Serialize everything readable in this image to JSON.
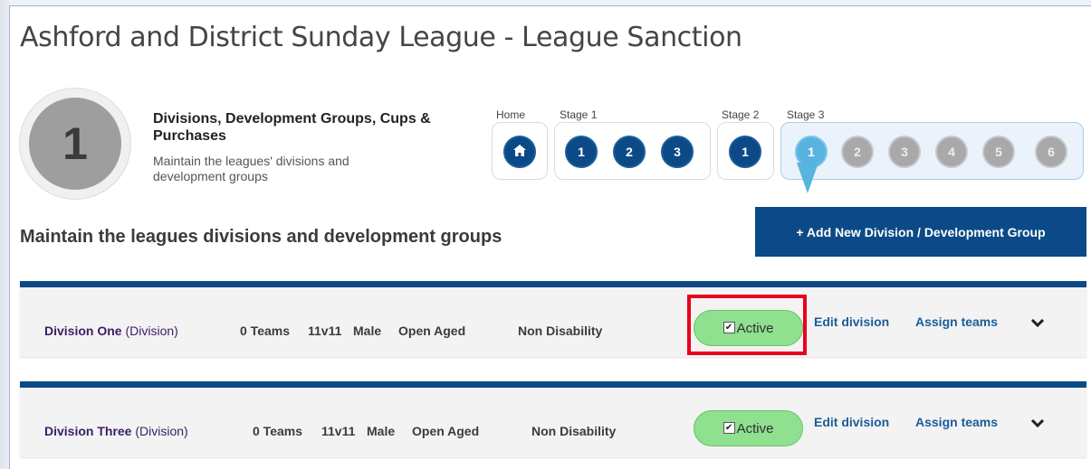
{
  "page": {
    "title": "Ashford and District Sunday League - League Sanction"
  },
  "stage_badge": {
    "number": "1"
  },
  "info": {
    "title": "Divisions, Development Groups, Cups & Purchases",
    "description": "Maintain the leagues' divisions and development groups"
  },
  "stepper": {
    "home_label": "Home",
    "stage1_label": "Stage 1",
    "stage2_label": "Stage 2",
    "stage3_label": "Stage 3",
    "stage1_steps": [
      "1",
      "2",
      "3"
    ],
    "stage2_steps": [
      "1"
    ],
    "stage3_steps": [
      "1",
      "2",
      "3",
      "4",
      "5",
      "6"
    ],
    "home_icon": "home-icon",
    "current_step": "Stage 3 step 1"
  },
  "section": {
    "heading": "Maintain the leagues divisions and development groups",
    "add_button_label": "+ Add New Division / Development Group"
  },
  "divisions": [
    {
      "name": "Division One",
      "type": "(Division)",
      "teams": "0 Teams",
      "format": "11v11",
      "gender": "Male",
      "age": "Open Aged",
      "disability": "Non Disability",
      "status_label": "Active",
      "edit_label": "Edit division",
      "assign_label": "Assign teams"
    },
    {
      "name": "Division Three",
      "type": "(Division)",
      "teams": "0 Teams",
      "format": "11v11",
      "gender": "Male",
      "age": "Open Aged",
      "disability": "Non Disability",
      "status_label": "Active",
      "edit_label": "Edit division",
      "assign_label": "Assign teams"
    }
  ],
  "colors": {
    "brand_blue": "#0b4a86",
    "current_step": "#59b3e0",
    "active_green": "#8fe08f",
    "highlight_red": "#e8001c",
    "division_name": "#3a1e67"
  }
}
